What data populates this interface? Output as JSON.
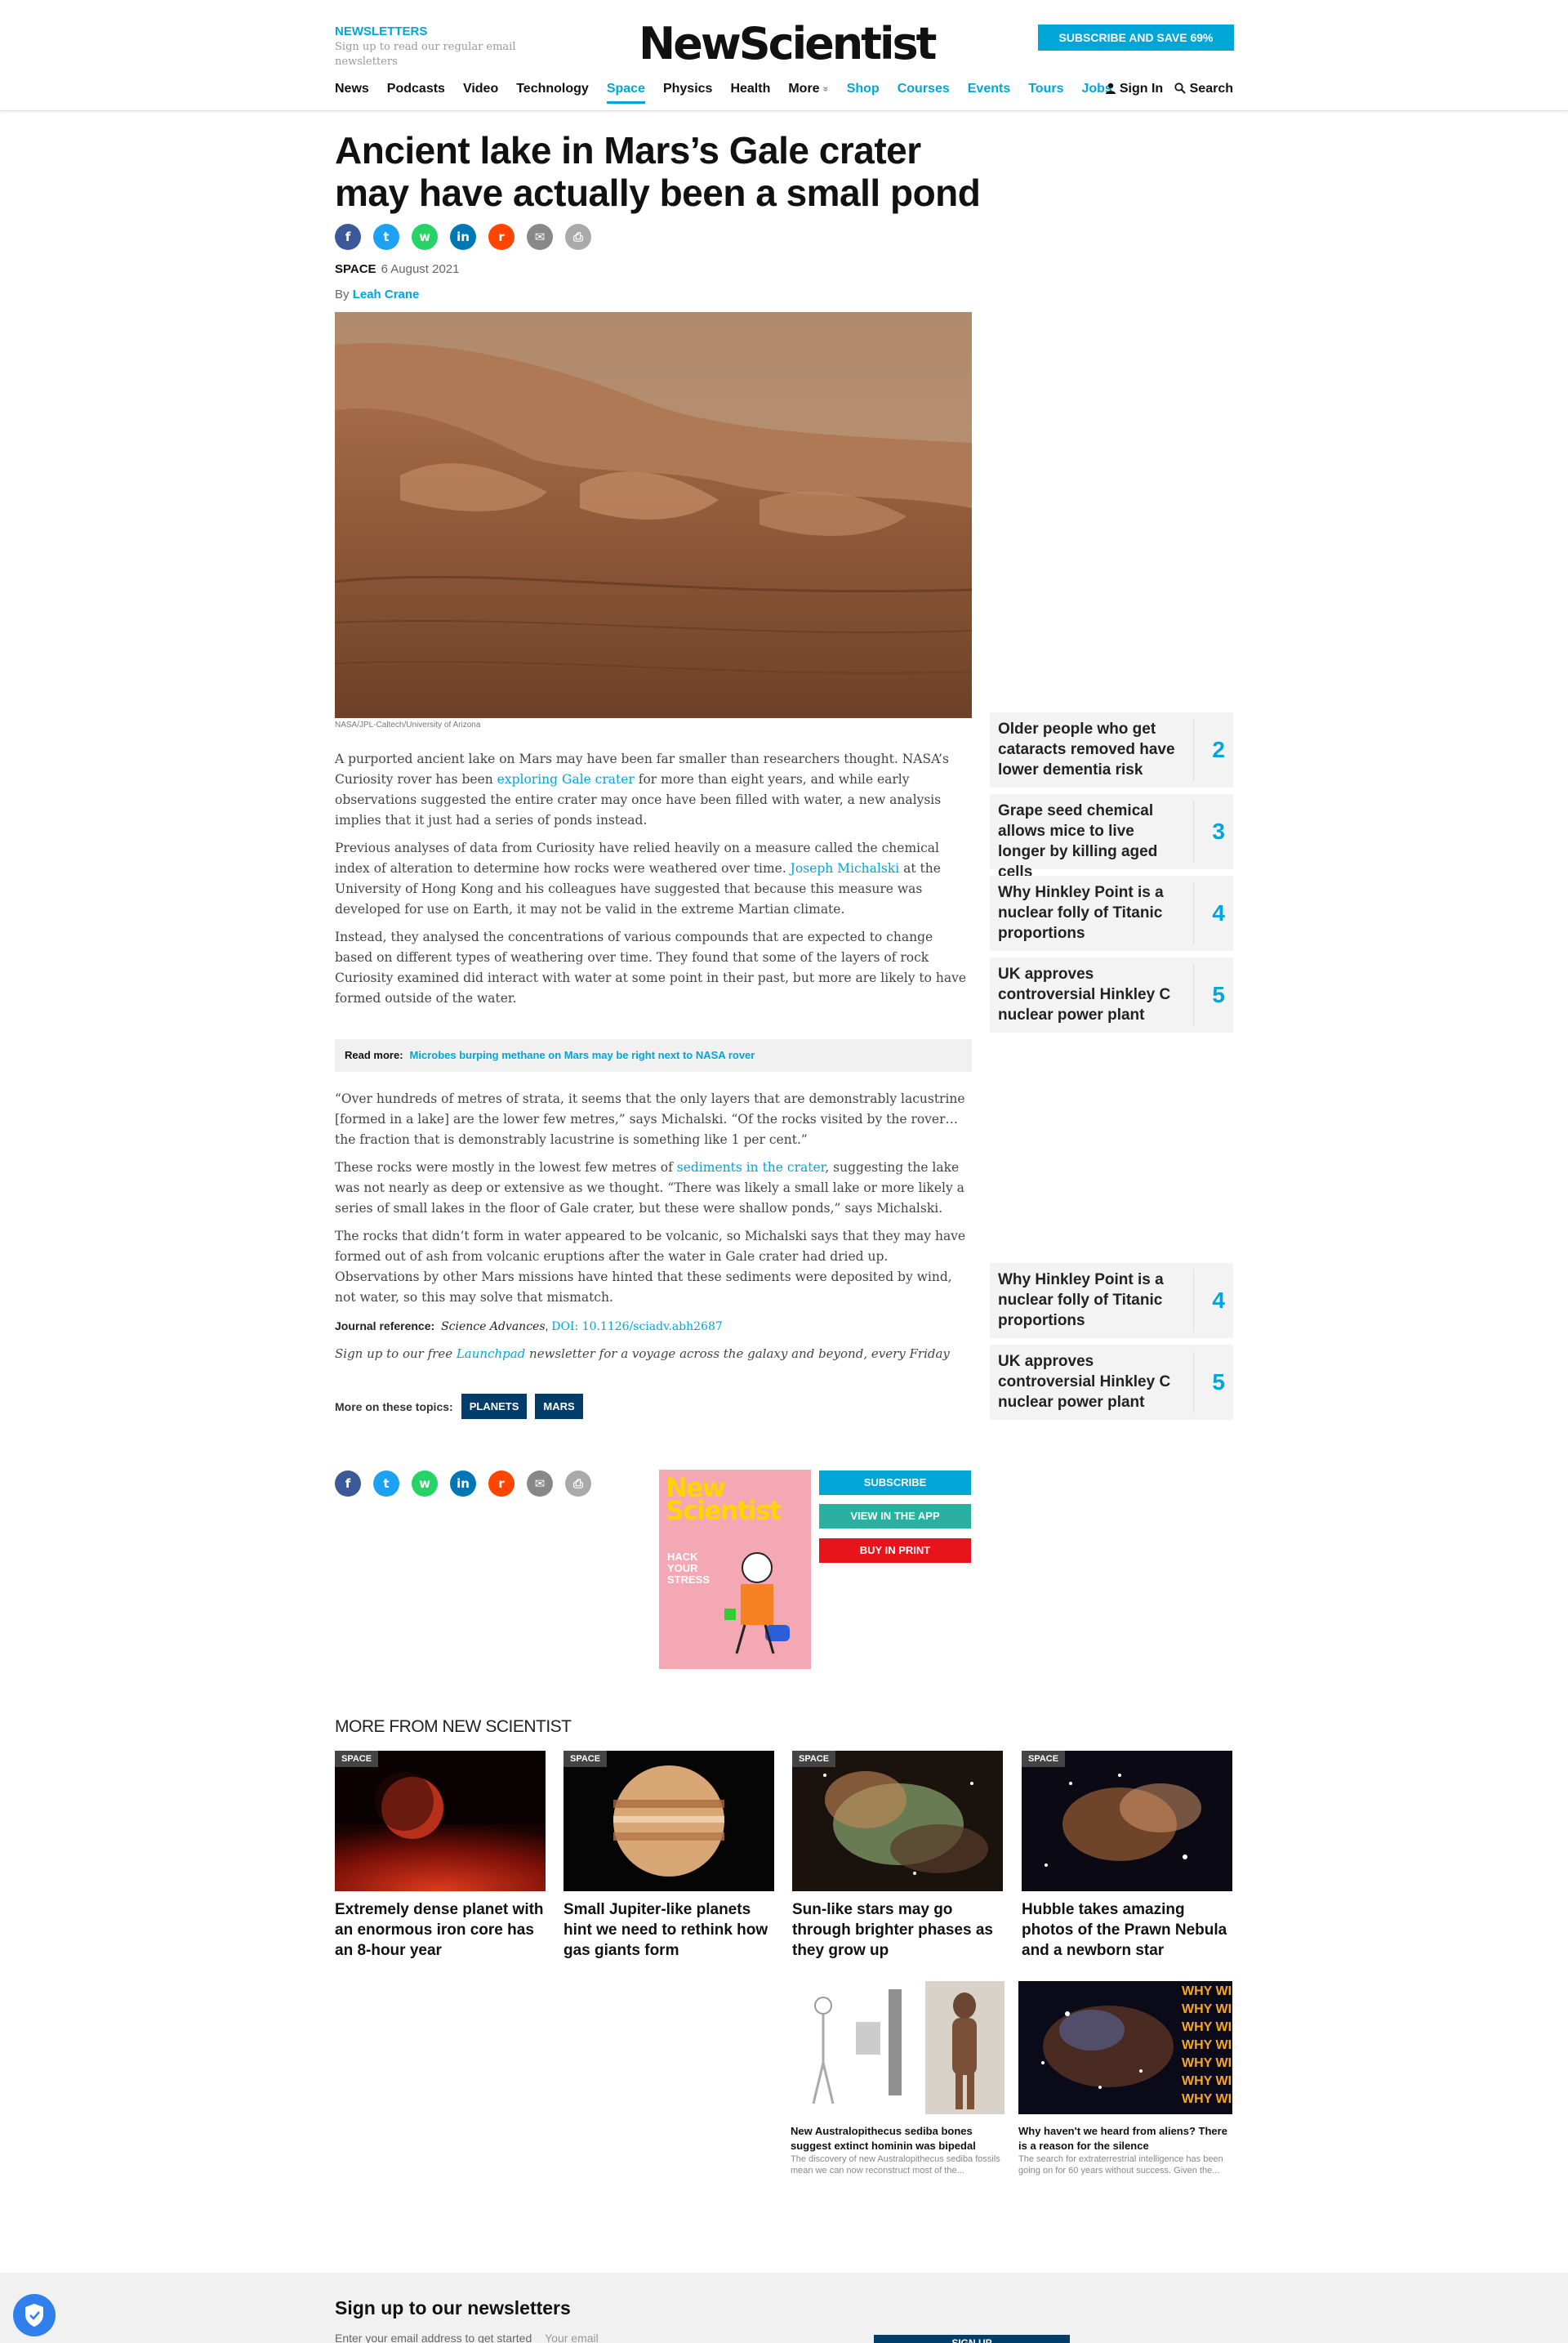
{
  "header": {
    "newsletters_title": "NEWSLETTERS",
    "newsletters_sub": "Sign up to read our regular email newsletters",
    "logo": "NewScientist",
    "subscribe_button": "SUBSCRIBE AND SAVE 69%",
    "nav": [
      "News",
      "Podcasts",
      "Video",
      "Technology",
      "Space",
      "Physics",
      "Health",
      "More",
      "Shop",
      "Courses",
      "Events",
      "Tours",
      "Jobs"
    ],
    "nav_more_arrow": "»",
    "sign_in": "Sign In",
    "search": "Search"
  },
  "article": {
    "headline": "Ancient lake in Mars’s Gale crater may have actually been a small pond",
    "section": "SPACE",
    "date": "6 August 2021",
    "by": "By",
    "author": "Leah Crane",
    "image_caption": "NASA/JPL-Caltech/University of Arizona",
    "p1_a": "A purported ancient lake on Mars may have been far smaller than researchers thought. NASA’s Curiosity rover has been ",
    "p1_link": "exploring Gale crater",
    "p1_b": " for more than eight years, and while early observations suggested the entire crater may once have been filled with water, a new analysis implies that it just had a series of ponds instead.",
    "p2_a": "Previous analyses of data from Curiosity have relied heavily on a measure called the chemical index of alteration to determine how rocks were weathered over time. ",
    "p2_link": "Joseph Michalski",
    "p2_b": " at the University of Hong Kong and his colleagues have suggested that because this measure was developed for use on Earth, it may not be valid in the extreme Martian climate.",
    "p3": "Instead, they analysed the concentrations of various compounds that are expected to change based on different types of weathering over time. They found that some of the layers of rock Curiosity examined did interact with water at some point in their past, but more are likely to have formed outside of the water.",
    "read_more_label": "Read more:",
    "read_more_link": "Microbes burping methane on Mars may be right next to NASA rover",
    "p4": "“Over hundreds of metres of strata, it seems that the only layers that are demonstrably lacustrine [formed in a lake] are the lower few metres,” says Michalski. “Of the rocks visited by the rover… the fraction that is demonstrably lacustrine is something like 1 per cent.”",
    "p5_a": "These rocks were mostly in the lowest few metres of ",
    "p5_link": "sediments in the crater",
    "p5_b": ", suggesting the lake was not nearly as deep or extensive as we thought. “There was likely a small lake or more likely a series of small lakes in the floor of Gale crater, but these were shallow ponds,” says Michalski.",
    "p6": "The rocks that didn’t form in water appeared to be volcanic, so Michalski says that they may have formed out of ash from volcanic eruptions after the water in Gale crater had dried up. Observations by other Mars missions have hinted that these sediments were deposited by wind, not water, so this may solve that mismatch.",
    "journal_label": "Journal reference:",
    "journal_name": "Science Advances",
    "journal_doi": "DOI: 10.1126/sciadv.abh2687",
    "signup_a": "Sign up to our free ",
    "signup_link": "Launchpad",
    "signup_b": " newsletter for a voyage across the galaxy and beyond, every Friday",
    "topics_label": "More on these topics:",
    "topics": [
      "PLANETS",
      "MARS"
    ]
  },
  "magazine": {
    "title_line1": "New",
    "title_line2": "Scientist",
    "cover_text": "HACK YOUR STRESS",
    "subscribe": "SUBSCRIBE",
    "app": "VIEW IN THE APP",
    "print": "BUY IN PRINT"
  },
  "sidebar": [
    {
      "text": "Older people who get cataracts removed have lower dementia risk",
      "num": "2"
    },
    {
      "text": "Grape seed chemical allows mice to live longer by killing aged cells",
      "num": "3"
    },
    {
      "text": "Why Hinkley Point is a nuclear folly of Titanic proportions",
      "num": "4"
    },
    {
      "text": "UK approves controversial Hinkley C nuclear power plant",
      "num": "5"
    }
  ],
  "sidebar2": [
    {
      "text": "Why Hinkley Point is a nuclear folly of Titanic proportions",
      "num": "4"
    },
    {
      "text": "UK approves controversial Hinkley C nuclear power plant",
      "num": "5"
    }
  ],
  "more": {
    "title": "MORE FROM NEW SCIENTIST",
    "cards": [
      {
        "tag": "SPACE",
        "title": "Extremely dense planet with an enormous iron core has an 8-hour year"
      },
      {
        "tag": "SPACE",
        "title": "Small Jupiter-like planets hint we need to rethink how gas giants form"
      },
      {
        "tag": "SPACE",
        "title": "Sun-like stars may go through brighter phases as they grow up"
      },
      {
        "tag": "SPACE",
        "title": "Hubble takes amazing photos of the Prawn Nebula and a newborn star"
      }
    ],
    "promos": [
      {
        "title": "New Australopithecus sediba bones suggest extinct hominin was bipedal",
        "desc": "The discovery of new Australopithecus sediba fossils mean we can now reconstruct most of the..."
      },
      {
        "title": "Why haven't we heard from aliens? There is a reason for the silence",
        "desc": "The search for extraterrestrial intelligence has been going on for 60 years without success. Given the...",
        "overlay": "WHY WI"
      }
    ]
  },
  "footer": {
    "title": "Sign up to our newsletters",
    "sub": "Enter your email address to get started",
    "email_placeholder": "Your email",
    "button": "SIGN UP"
  },
  "colors": {
    "accent": "#00a6d8",
    "navy": "#003d6b",
    "app_green": "#2ab0a0",
    "print_red": "#e8141c"
  }
}
